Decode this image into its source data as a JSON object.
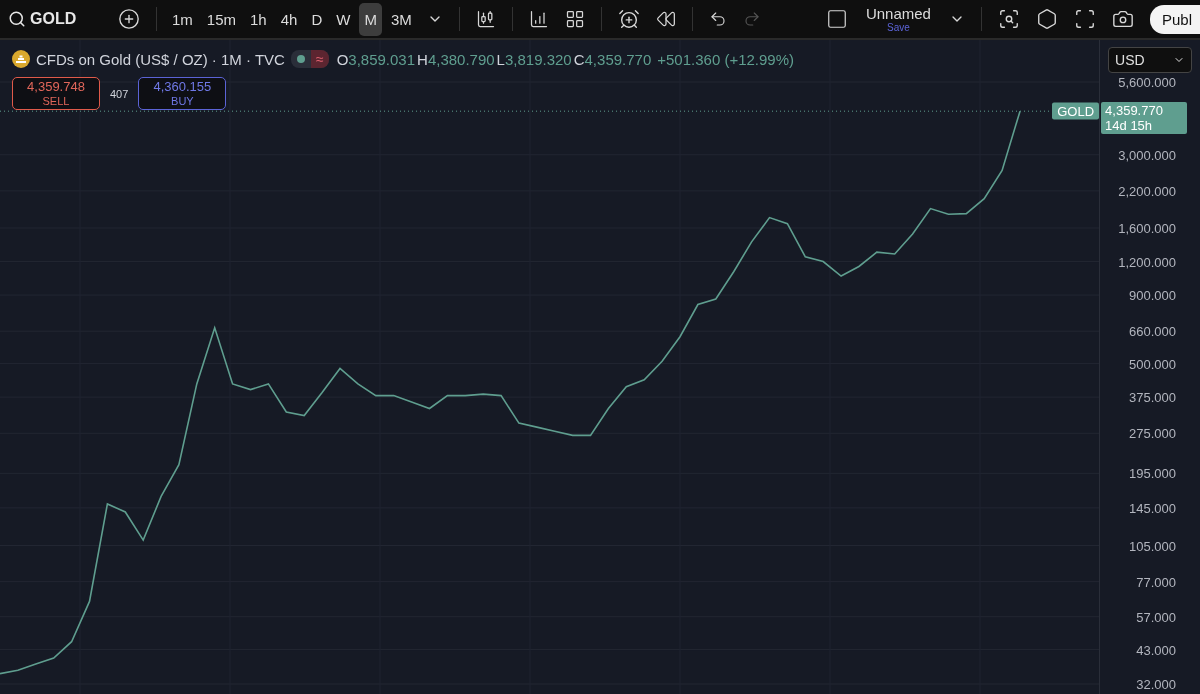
{
  "toolbar": {
    "symbol": "GOLD",
    "intervals": [
      {
        "label": "1m",
        "selected": false
      },
      {
        "label": "15m",
        "selected": false
      },
      {
        "label": "1h",
        "selected": false
      },
      {
        "label": "4h",
        "selected": false
      },
      {
        "label": "D",
        "selected": false
      },
      {
        "label": "W",
        "selected": false
      },
      {
        "label": "M",
        "selected": true
      },
      {
        "label": "3M",
        "selected": false
      }
    ],
    "undo_disabled": false,
    "redo_disabled": true,
    "layout_name": "Unnamed",
    "save_label": "Save",
    "publish_label": "Publ"
  },
  "legend": {
    "title": "CFDs on Gold (US$ / OZ) · 1M · TVC",
    "status_mark": "≈",
    "ohlc": [
      {
        "key": "O",
        "value": "3,859.031"
      },
      {
        "key": "H",
        "value": "4,380.790"
      },
      {
        "key": "L",
        "value": "3,819.320"
      },
      {
        "key": "C",
        "value": "4,359.770"
      }
    ],
    "change": "+501.360 (+12.99%)"
  },
  "trade": {
    "sell_price": "4,359.748",
    "sell_label": "SELL",
    "spread": "407",
    "buy_price": "4,360.155",
    "buy_label": "BUY"
  },
  "price_axis": {
    "currency": "USD",
    "tag_label": "GOLD",
    "last_price": "4,359.770",
    "countdown": "14d 15h",
    "labels": [
      "5,600.000",
      "3,000.000",
      "2,200.000",
      "1,600.000",
      "1,200.000",
      "900.000",
      "660.000",
      "500.000",
      "375.000",
      "275.000",
      "195.000",
      "145.000",
      "105.000",
      "77.000",
      "57.000",
      "43.000",
      "32.000"
    ]
  }
}
